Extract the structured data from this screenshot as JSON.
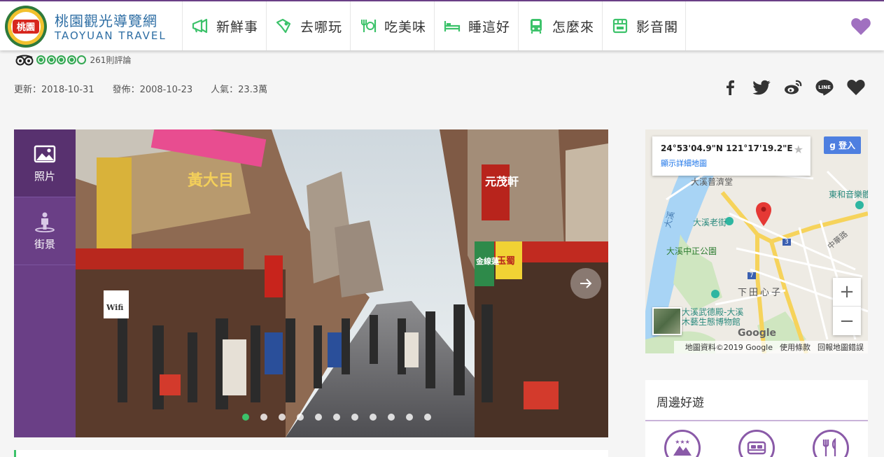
{
  "header": {
    "logo_text": "桃園",
    "brand_zh": "桃園觀光導覽網",
    "brand_en": "TAOYUAN TRAVEL",
    "nav": [
      {
        "label": "新鮮事",
        "icon": "megaphone-icon"
      },
      {
        "label": "去哪玩",
        "icon": "map-route-icon"
      },
      {
        "label": "吃美味",
        "icon": "utensils-icon"
      },
      {
        "label": "睡這好",
        "icon": "bed-icon"
      },
      {
        "label": "怎麼來",
        "icon": "bus-icon"
      },
      {
        "label": "影音閣",
        "icon": "video-icon"
      }
    ],
    "favorite_icon": "heart-icon"
  },
  "rating": {
    "stars_filled": 4,
    "stars_total": 5,
    "reviews": "261則評論"
  },
  "meta": {
    "updated": "更新：2018-10-31",
    "published": "發佈：2008-10-23",
    "popularity": "人氣：23.3萬"
  },
  "share": [
    "facebook-icon",
    "twitter-icon",
    "weibo-icon",
    "line-icon",
    "heart-icon"
  ],
  "gallery": {
    "tabs": [
      {
        "label": "照片",
        "icon": "image-icon"
      },
      {
        "label": "街景",
        "icon": "street-view-icon"
      }
    ],
    "sign_texts": [
      "黃大目",
      "元茂軒",
      "玉蜀",
      "金線蓮",
      "Wifi"
    ],
    "slide_count": 11,
    "active_slide": 1
  },
  "map": {
    "coordinates": "24°53'04.9\"N 121°17'19.2\"E",
    "detail_link": "顯示詳細地圖",
    "login": "登入",
    "labels": [
      "大溪普濟堂",
      "東和音樂體",
      "大溪老街",
      "大溪中正公園",
      "下田心子",
      "大溪武德殿-大溪",
      "木藝生態博物館",
      "中華路",
      "大溪",
      "3",
      "7"
    ],
    "zoom_in": "+",
    "zoom_out": "−",
    "footer": [
      "地圖資料©2019 Google",
      "使用條款",
      "回報地圖錯誤"
    ],
    "google": "Google"
  },
  "nearby": {
    "title": "周邊好遊",
    "icons": [
      "attractions-icon",
      "lodging-icon",
      "dining-icon"
    ]
  }
}
